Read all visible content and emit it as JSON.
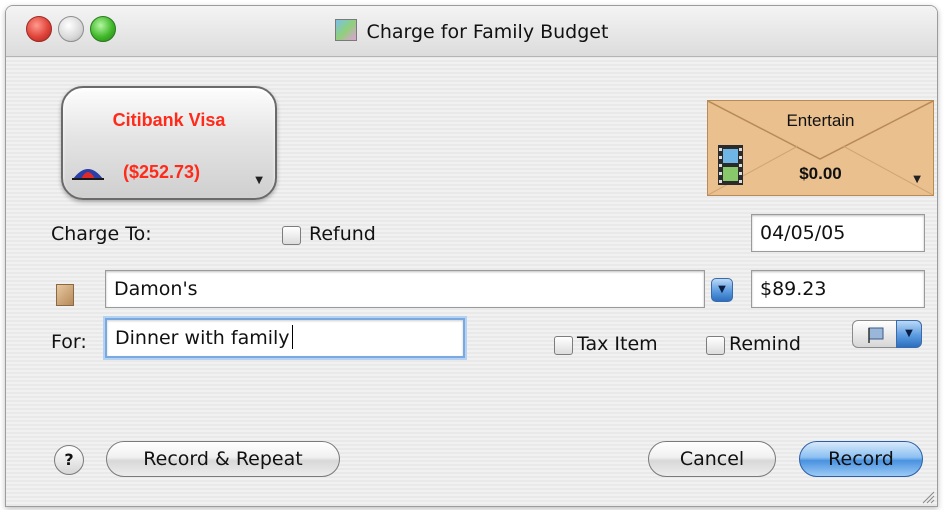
{
  "window": {
    "title": "Charge for Family Budget"
  },
  "account_card": {
    "name": "Citibank Visa",
    "balance": "($252.73)",
    "color": "#ff2a1a"
  },
  "envelope": {
    "category": "Entertain",
    "amount": "$0.00",
    "icon": "film-strip-icon"
  },
  "form": {
    "charge_to_label": "Charge To:",
    "refund_label": "Refund",
    "refund_checked": false,
    "date_value": "04/05/05",
    "payee_value": "Damon's",
    "amount_value": "$89.23",
    "for_label": "For:",
    "memo_value": "Dinner with family",
    "tax_item_label": "Tax Item",
    "tax_item_checked": false,
    "remind_label": "Remind",
    "remind_checked": false
  },
  "buttons": {
    "help": "?",
    "record_repeat": "Record & Repeat",
    "cancel": "Cancel",
    "record": "Record"
  }
}
